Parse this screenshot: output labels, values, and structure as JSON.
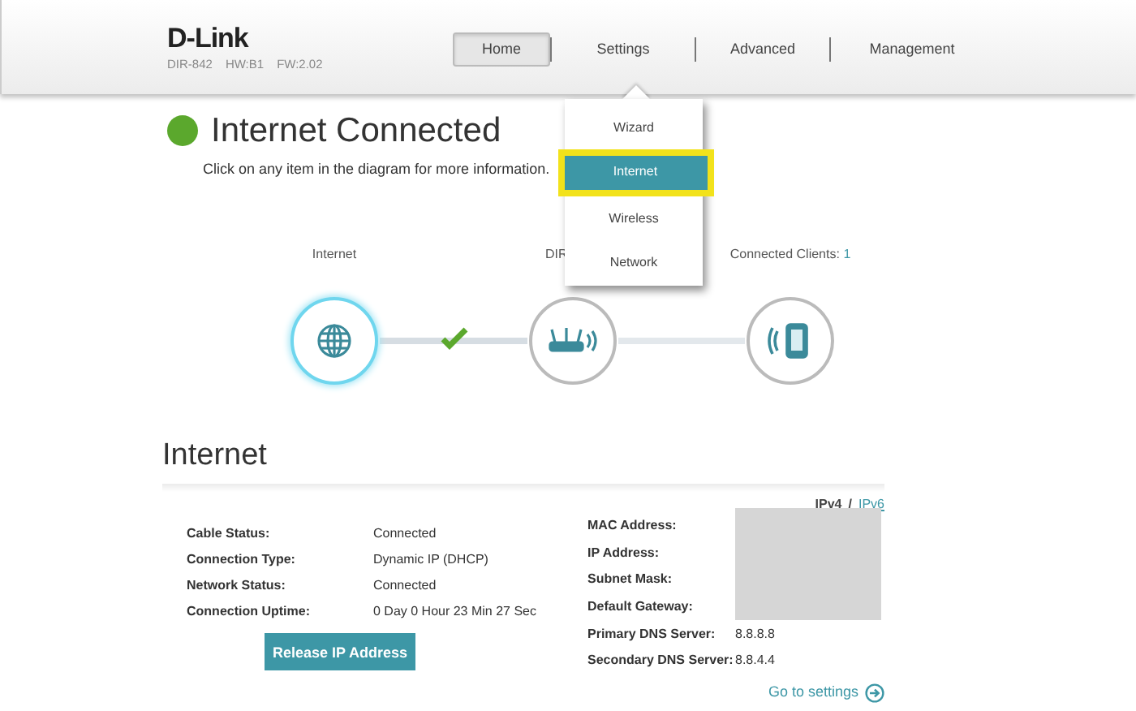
{
  "header": {
    "logo": "D-Link",
    "model": [
      "DIR-842",
      "HW:B1",
      "FW:2.02"
    ]
  },
  "nav": [
    {
      "label": "Home",
      "selected": true
    },
    {
      "label": "Settings",
      "selected": false
    },
    {
      "label": "Advanced",
      "selected": false
    },
    {
      "label": "Management",
      "selected": false
    }
  ],
  "settings_menu": [
    {
      "label": "Wizard",
      "selected": false
    },
    {
      "label": "Internet",
      "selected": true
    },
    {
      "label": "Wireless",
      "selected": false
    },
    {
      "label": "Network",
      "selected": false
    }
  ],
  "status": {
    "title": "Internet Connected",
    "connected": true,
    "subtitle": "Click on any item in the diagram for more information."
  },
  "diagram": {
    "nodes": [
      {
        "kind": "internet",
        "label": "Internet",
        "active": true
      },
      {
        "kind": "router",
        "label": "DIR",
        "active": false
      },
      {
        "kind": "clients",
        "label": "Connected Clients:",
        "count": "1",
        "active": false
      }
    ],
    "links": [
      {
        "ok": true
      },
      {
        "ok": false
      }
    ]
  },
  "section": {
    "title": "Internet",
    "ip_versions": [
      {
        "label": "IPv4",
        "selected": true
      },
      {
        "label": "IPv6",
        "selected": false
      }
    ],
    "ip_separator": "/",
    "left_rows": [
      {
        "label": "Cable Status:",
        "value": "Connected"
      },
      {
        "label": "Connection Type:",
        "value": "Dynamic IP (DHCP)"
      },
      {
        "label": "Network Status:",
        "value": "Connected"
      },
      {
        "label": "Connection Uptime:",
        "value": "0 Day 0 Hour 23 Min 27 Sec"
      }
    ],
    "right_rows": [
      {
        "label": "MAC Address:",
        "redacted": true
      },
      {
        "label": "IP Address:",
        "redacted": true
      },
      {
        "label": "Subnet Mask:",
        "redacted": true
      },
      {
        "label": "Default Gateway:",
        "redacted": true
      },
      {
        "label": "Primary DNS Server:",
        "value": "8.8.8.8",
        "redacted": false
      },
      {
        "label": "Secondary DNS Server:",
        "value": "8.8.4.4",
        "redacted": false
      }
    ],
    "button": "Release IP Address",
    "link": "Go to settings"
  }
}
